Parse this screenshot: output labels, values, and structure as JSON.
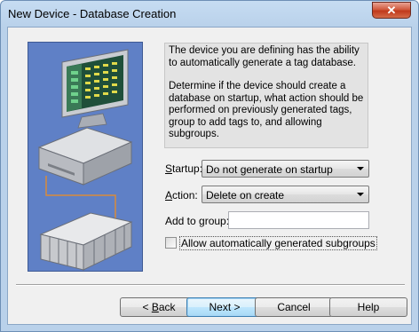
{
  "window": {
    "title": "New Device - Database Creation",
    "close_glyph": "✕"
  },
  "description": {
    "paragraph1": "The device you are defining has the ability to automatically generate a tag database.",
    "paragraph2": "Determine if the device should create a database on startup, what action should be performed on previously generated tags, group to add tags to, and allowing subgroups."
  },
  "form": {
    "startup": {
      "label_mnemonic": "S",
      "label_rest": "tartup:",
      "value": "Do not generate on startup"
    },
    "action": {
      "label_mnemonic": "A",
      "label_rest": "ction:",
      "value": "Delete on create"
    },
    "add_to_group": {
      "label": "Add to group:",
      "value": ""
    },
    "allow_subgroups": {
      "label": "Allow automatically generated subgroups",
      "checked": false
    }
  },
  "buttons": {
    "back": {
      "pre": "< ",
      "mnemonic": "B",
      "rest": "ack"
    },
    "next": "Next >",
    "cancel": "Cancel",
    "help": "Help"
  },
  "icons": {
    "illustration": "computer-and-plc-illustration"
  }
}
